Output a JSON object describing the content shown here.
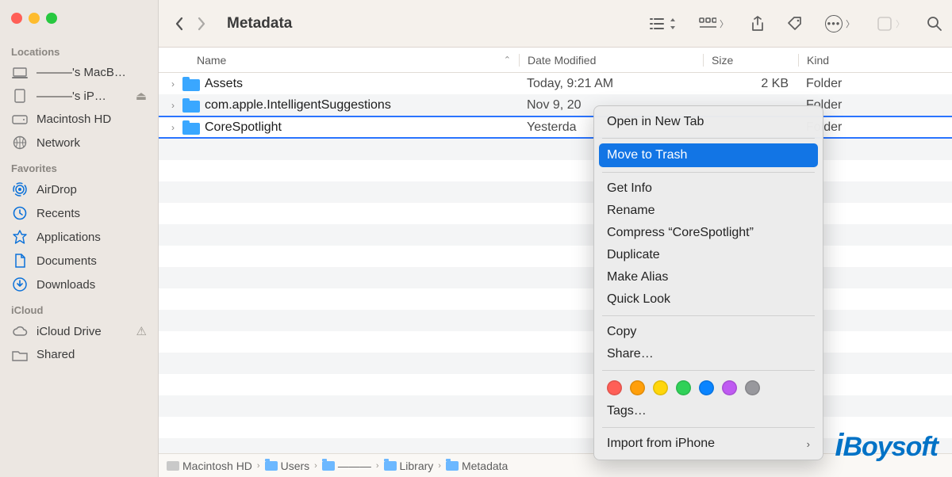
{
  "window_title": "Metadata",
  "sidebar": {
    "sections": [
      {
        "label": "Locations",
        "items": [
          {
            "icon": "laptop",
            "iconColor": "gray",
            "label": "———'s MacB…",
            "trailing": ""
          },
          {
            "icon": "ipad",
            "iconColor": "gray",
            "label": "———'s iP…",
            "trailing": "⏏"
          },
          {
            "icon": "hd",
            "iconColor": "gray",
            "label": "Macintosh HD",
            "trailing": ""
          },
          {
            "icon": "globe",
            "iconColor": "gray",
            "label": "Network",
            "trailing": ""
          }
        ]
      },
      {
        "label": "Favorites",
        "items": [
          {
            "icon": "airdrop",
            "iconColor": "blue",
            "label": "AirDrop"
          },
          {
            "icon": "clock",
            "iconColor": "blue",
            "label": "Recents"
          },
          {
            "icon": "apps",
            "iconColor": "blue",
            "label": "Applications"
          },
          {
            "icon": "doc",
            "iconColor": "blue",
            "label": "Documents"
          },
          {
            "icon": "download",
            "iconColor": "blue",
            "label": "Downloads"
          }
        ]
      },
      {
        "label": "iCloud",
        "items": [
          {
            "icon": "cloud",
            "iconColor": "gray",
            "label": "iCloud Drive",
            "trailing": "⚠︎"
          },
          {
            "icon": "shared",
            "iconColor": "gray",
            "label": "Shared"
          }
        ]
      }
    ]
  },
  "columns": {
    "name": "Name",
    "date": "Date Modified",
    "size": "Size",
    "kind": "Kind"
  },
  "rows": [
    {
      "name": "Assets",
      "date": "Today, 9:21 AM",
      "size": "2 KB",
      "kind": "Folder",
      "selected": false
    },
    {
      "name": "com.apple.IntelligentSuggestions",
      "date": "Nov 9, 20",
      "size": "",
      "kind": "Folder",
      "selected": false
    },
    {
      "name": "CoreSpotlight",
      "date": "Yesterda",
      "size": "",
      "kind": "Folder",
      "selected": true
    }
  ],
  "context_menu": {
    "items_top": [
      "Open in New Tab"
    ],
    "highlighted": "Move to Trash",
    "items_mid": [
      "Get Info",
      "Rename",
      "Compress “CoreSpotlight”",
      "Duplicate",
      "Make Alias",
      "Quick Look"
    ],
    "items_copy": [
      "Copy",
      "Share…"
    ],
    "tag_colors": [
      "#ff5f57",
      "#ff9f0a",
      "#ffd60a",
      "#30d158",
      "#0a84ff",
      "#bf5af2",
      "#98989d"
    ],
    "tags_label": "Tags…",
    "import_label": "Import from iPhone"
  },
  "pathbar": [
    "Macintosh HD",
    "Users",
    "———",
    "Library",
    "Metadata"
  ],
  "watermark": "iBoysoft"
}
